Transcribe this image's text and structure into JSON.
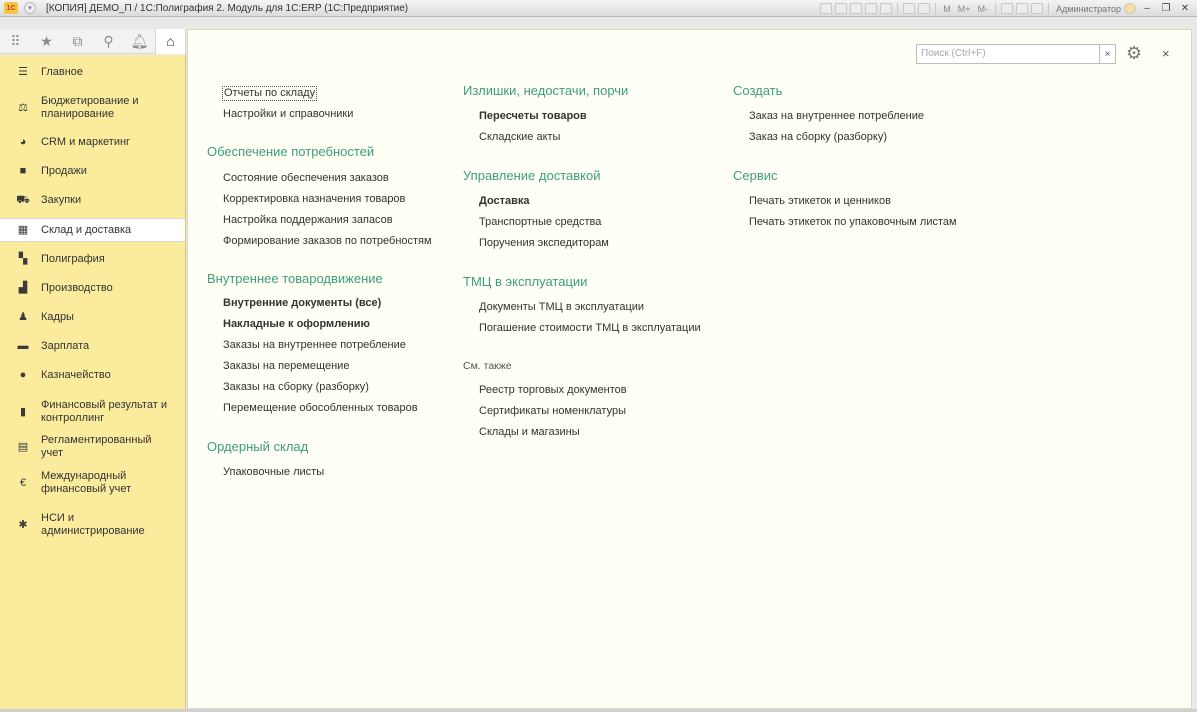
{
  "titlebar": {
    "app_logo": "1С",
    "title": "[КОПИЯ] ДЕМО_П / 1С:Полиграфия 2. Модуль для 1С:ERP  (1С:Предприятие)",
    "tool_text": [
      "M",
      "M+",
      "M-"
    ],
    "user": "Администратор"
  },
  "topnav": {
    "icons": [
      "apps-icon",
      "star-icon",
      "history-icon",
      "search-icon",
      "bell-icon",
      "home-icon"
    ]
  },
  "sidebar": {
    "items": [
      {
        "label": "Главное",
        "icon": "menu-icon",
        "glyph": "☰"
      },
      {
        "label": "Бюджетирование и планирование",
        "icon": "budget-icon",
        "glyph": "⚖"
      },
      {
        "label": "CRM и маркетинг",
        "icon": "pie-icon",
        "glyph": "◕"
      },
      {
        "label": "Продажи",
        "icon": "bag-icon",
        "glyph": "■"
      },
      {
        "label": "Закупки",
        "icon": "cart-icon",
        "glyph": "⛟"
      },
      {
        "label": "Склад и доставка",
        "icon": "warehouse-icon",
        "glyph": "▦"
      },
      {
        "label": "Полиграфия",
        "icon": "printing-icon",
        "glyph": "▚"
      },
      {
        "label": "Производство",
        "icon": "factory-icon",
        "glyph": "▟"
      },
      {
        "label": "Кадры",
        "icon": "person-icon",
        "glyph": "♟"
      },
      {
        "label": "Зарплата",
        "icon": "wallet-icon",
        "glyph": "▬"
      },
      {
        "label": "Казначейство",
        "icon": "coin-icon",
        "glyph": "●"
      },
      {
        "label": "Финансовый результат и контроллинг",
        "icon": "bars-icon",
        "glyph": "▮"
      },
      {
        "label": "Регламентированный учет",
        "icon": "calculator-icon",
        "glyph": "▤"
      },
      {
        "label": "Международный финансовый учет",
        "icon": "euro-icon",
        "glyph": "€"
      },
      {
        "label": "НСИ и администрирование",
        "icon": "gear-icon",
        "glyph": "✱"
      }
    ]
  },
  "search": {
    "placeholder": "Поиск (Ctrl+F)",
    "clear": "×"
  },
  "content": {
    "close": "×",
    "col1": {
      "top_links": [
        "Отчеты по складу",
        "Настройки и справочники"
      ],
      "sections": [
        {
          "title": "Обеспечение потребностей",
          "links": [
            "Состояние обеспечения заказов",
            "Корректировка назначения товаров",
            "Настройка поддержания запасов",
            "Формирование заказов по потребностям"
          ]
        },
        {
          "title": "Внутреннее товародвижение",
          "links": [
            "Внутренние документы (все)",
            "Накладные к оформлению",
            "Заказы на внутреннее потребление",
            "Заказы на перемещение",
            "Заказы на сборку (разборку)",
            "Перемещение обособленных товаров"
          ]
        },
        {
          "title": "Ордерный склад",
          "links": [
            "Упаковочные листы"
          ]
        }
      ]
    },
    "col2": {
      "sections": [
        {
          "title": "Излишки, недостачи, порчи",
          "links": [
            "Пересчеты товаров",
            "Складские акты"
          ]
        },
        {
          "title": "Управление доставкой",
          "links": [
            "Доставка",
            "Транспортные средства",
            "Поручения экспедиторам"
          ]
        },
        {
          "title": "ТМЦ в эксплуатации",
          "links": [
            "Документы ТМЦ в эксплуатации",
            "Погашение стоимости ТМЦ в эксплуатации"
          ]
        }
      ],
      "see_also_title": "См. также",
      "see_also_links": [
        "Реестр торговых документов",
        "Сертификаты номенклатуры",
        "Склады и магазины"
      ]
    },
    "col3": {
      "sections": [
        {
          "title": "Создать",
          "links": [
            "Заказ на внутреннее потребление",
            "Заказ на сборку (разборку)"
          ]
        },
        {
          "title": "Сервис",
          "links": [
            "Печать этикеток и ценников",
            "Печать этикеток по упаковочным листам"
          ]
        }
      ]
    }
  }
}
